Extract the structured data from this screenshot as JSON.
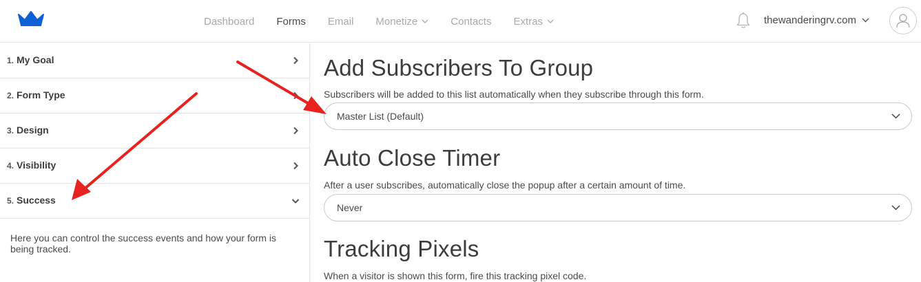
{
  "header": {
    "logo_icon": "crown-icon",
    "brand_color": "#0f5fd6",
    "nav": [
      {
        "label": "Dashboard",
        "active": false,
        "has_dropdown": false
      },
      {
        "label": "Forms",
        "active": true,
        "has_dropdown": false
      },
      {
        "label": "Email",
        "active": false,
        "has_dropdown": false
      },
      {
        "label": "Monetize",
        "active": false,
        "has_dropdown": true
      },
      {
        "label": "Contacts",
        "active": false,
        "has_dropdown": false
      },
      {
        "label": "Extras",
        "active": false,
        "has_dropdown": true
      }
    ],
    "notification_icon": "bell-icon",
    "account_label": "thewanderingrv.com",
    "avatar_icon": "user-icon"
  },
  "sidebar": {
    "steps": [
      {
        "num": "1.",
        "label": "My Goal",
        "expanded": false
      },
      {
        "num": "2.",
        "label": "Form Type",
        "expanded": false
      },
      {
        "num": "3.",
        "label": "Design",
        "expanded": false
      },
      {
        "num": "4.",
        "label": "Visibility",
        "expanded": false
      },
      {
        "num": "5.",
        "label": "Success",
        "expanded": true
      }
    ],
    "description": "Here you can control the success events and how your form is being tracked."
  },
  "main": {
    "sections": [
      {
        "title": "Add Subscribers To Group",
        "description": "Subscribers will be added to this list automatically when they subscribe through this form.",
        "select_value": "Master List (Default)"
      },
      {
        "title": "Auto Close Timer",
        "description": "After a user subscribes, automatically close the popup after a certain amount of time.",
        "select_value": "Never"
      },
      {
        "title": "Tracking Pixels",
        "description": "When a visitor is shown this form, fire this tracking pixel code."
      }
    ]
  },
  "annotations": {
    "arrow_color": "#e8231f"
  }
}
